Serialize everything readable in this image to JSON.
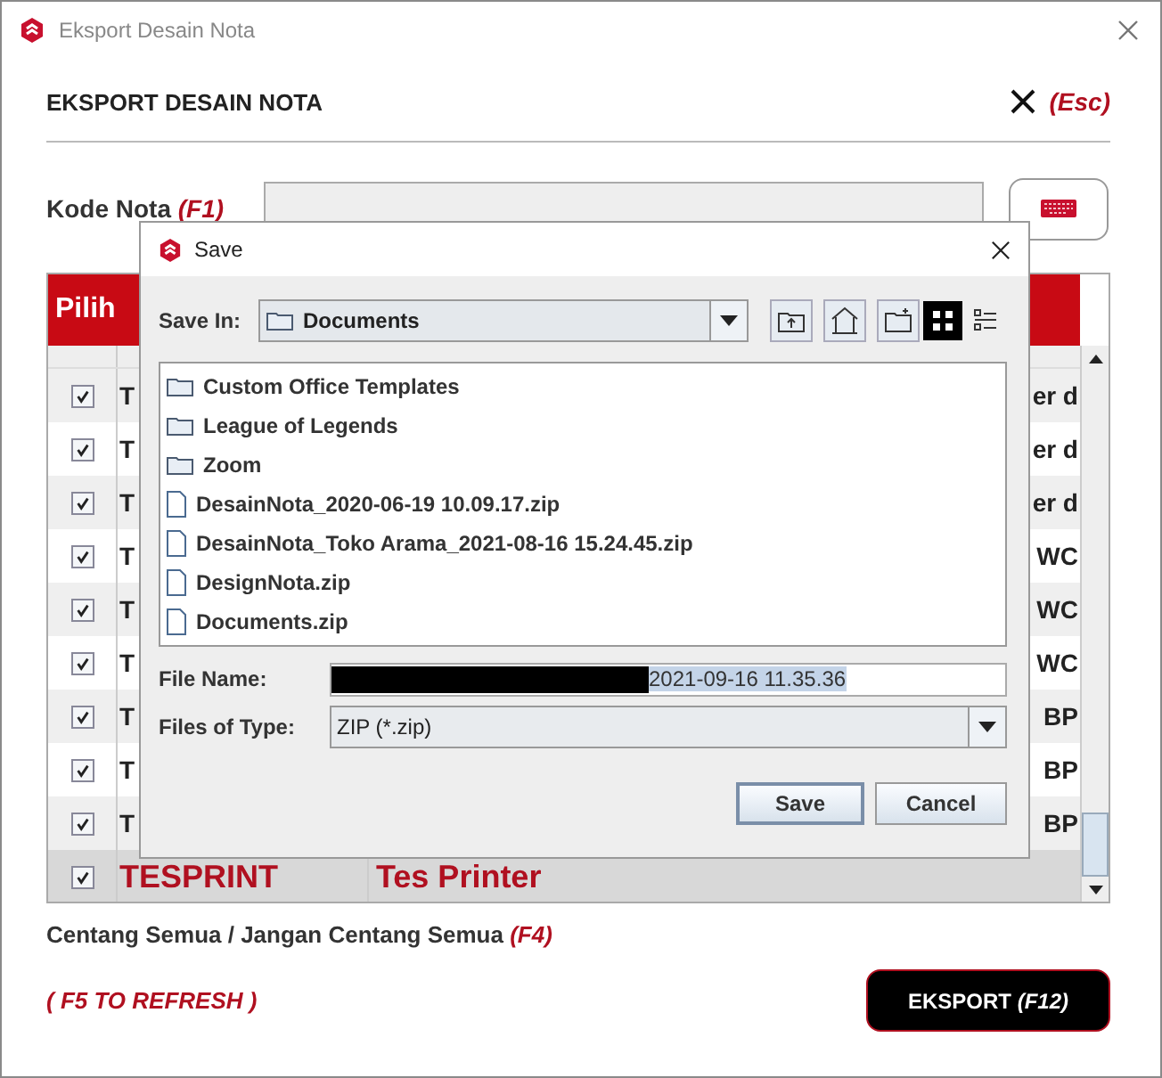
{
  "window": {
    "title": "Eksport Desain Nota"
  },
  "header": {
    "title": "EKSPORT DESAIN NOTA",
    "close_hint": "(Esc)"
  },
  "kode_nota": {
    "label": "Kode Nota",
    "hint": "(F1)"
  },
  "table": {
    "columns": [
      {
        "label": "Pilih"
      }
    ],
    "rows": [
      {
        "checked": true,
        "selected": false,
        "column_2": "T",
        "column_3": "er d"
      },
      {
        "checked": true,
        "selected": false,
        "column_2": "T",
        "column_3": "er d"
      },
      {
        "checked": true,
        "selected": false,
        "column_2": "T",
        "column_3": "er d"
      },
      {
        "checked": true,
        "selected": false,
        "column_2": "T",
        "column_3": "WC"
      },
      {
        "checked": true,
        "selected": false,
        "column_2": "T",
        "column_3": "WC"
      },
      {
        "checked": true,
        "selected": false,
        "column_2": "T",
        "column_3": "WC"
      },
      {
        "checked": true,
        "selected": false,
        "column_2": "T",
        "column_3": "BP"
      },
      {
        "checked": true,
        "selected": false,
        "column_2": "T",
        "column_3": "BP"
      },
      {
        "checked": true,
        "selected": false,
        "column_2": "T",
        "column_3": "BP"
      },
      {
        "checked": true,
        "selected": true,
        "column_2": "TESPRINT",
        "column_3": "Tes Printer"
      }
    ]
  },
  "select_all": {
    "label": "Centang Semua / Jangan Centang Semua",
    "hint": "(F4)"
  },
  "refresh_hint": "( F5 TO REFRESH )",
  "export_button": {
    "label": "EKSPORT",
    "hint": "(F12)"
  },
  "dialog": {
    "title": "Save",
    "save_in": {
      "label": "Save In:",
      "value": "Documents"
    },
    "view_modes": [
      {
        "selected": true
      },
      {
        "selected": false
      }
    ],
    "files": [
      {
        "kind": "folder",
        "name": "Custom Office Templates"
      },
      {
        "kind": "folder",
        "name": "League of Legends"
      },
      {
        "kind": "folder",
        "name": "Zoom"
      },
      {
        "kind": "file",
        "name": "DesainNota_2020-06-19 10.09.17.zip"
      },
      {
        "kind": "file",
        "name": "DesainNota_Toko Arama_2021-08-16 15.24.45.zip"
      },
      {
        "kind": "file",
        "name": "DesignNota.zip"
      },
      {
        "kind": "file",
        "name": "Documents.zip"
      }
    ],
    "file_name": {
      "label": "File Name:",
      "value": "2021-09-16 11.35.36",
      "redacted": true
    },
    "file_type": {
      "label": "Files of Type:",
      "value": "ZIP (*.zip)"
    },
    "buttons": [
      {
        "label": "Save",
        "default": true
      },
      {
        "label": "Cancel",
        "default": false
      }
    ]
  }
}
